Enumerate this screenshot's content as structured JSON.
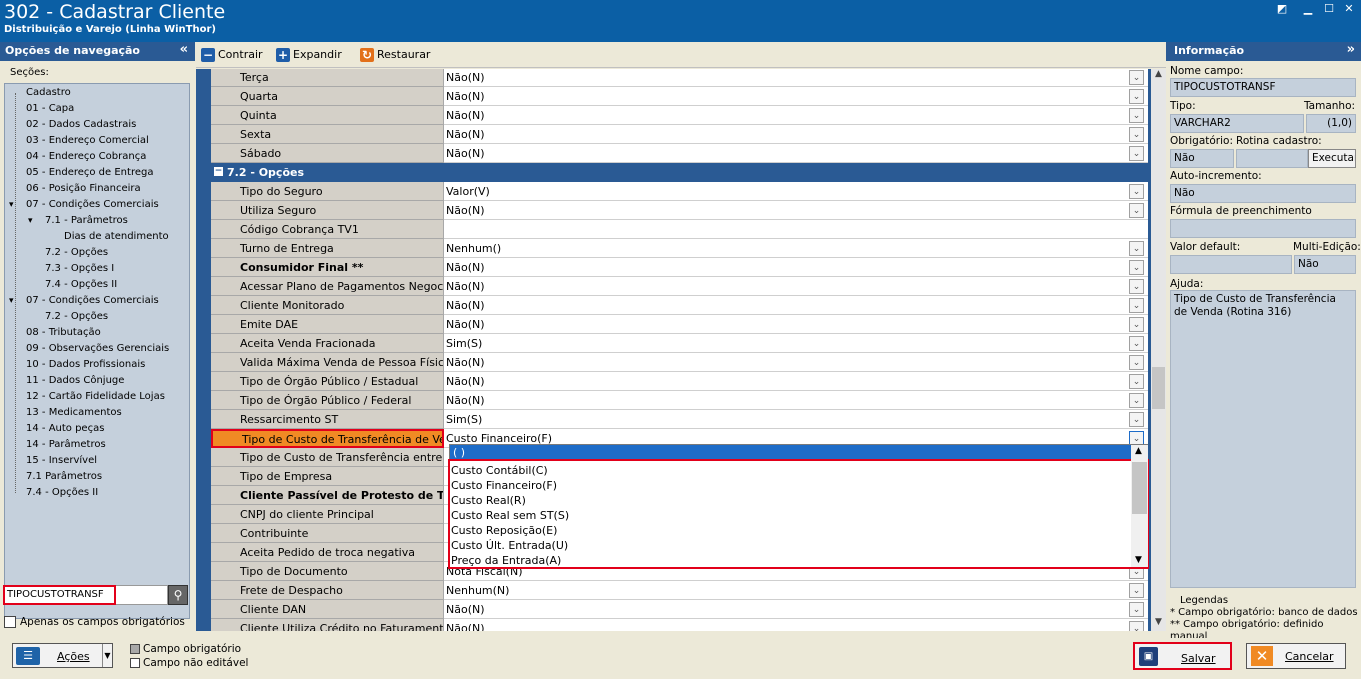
{
  "window": {
    "title": "302 - Cadastrar Cliente",
    "subtitle": "Distribuição e Varejo (Linha WinThor)"
  },
  "left": {
    "header": "Opções de navegação",
    "sections_label": "Seções:",
    "tree": [
      "Cadastro",
      "01 - Capa",
      "02 - Dados Cadastrais",
      "03 - Endereço Comercial",
      "04 - Endereço Cobrança",
      "05 - Endereço de Entrega",
      "06 - Posição Financeira",
      "07 - Condições Comerciais",
      "7.1 - Parâmetros",
      "Dias de atendimento",
      "7.2 - Opções",
      "7.3 - Opções I",
      "7.4 - Opções II",
      "07 - Condições Comerciais",
      "7.2 - Opções",
      "08 - Tributação",
      "09 - Observações Gerenciais",
      "10 - Dados Profissionais",
      "11 - Dados Cônjuge",
      "12 - Cartão Fidelidade Lojas",
      "13 - Medicamentos",
      "14 - Auto peças",
      "14 - Parâmetros",
      "15 - Inservível",
      "7.1 Parâmetros",
      "7.4 - Opções II"
    ],
    "search_value": "TIPOCUSTOTRANSF",
    "only_required": "Apenas os campos obrigatórios"
  },
  "toolbar": {
    "collapse": "Contrair",
    "expand": "Expandir",
    "restore": "Restaurar"
  },
  "grid": {
    "rows_top": [
      {
        "label": "Terça",
        "value": "Não(N)"
      },
      {
        "label": "Quarta",
        "value": "Não(N)"
      },
      {
        "label": "Quinta",
        "value": "Não(N)"
      },
      {
        "label": "Sexta",
        "value": "Não(N)"
      },
      {
        "label": "Sábado",
        "value": "Não(N)"
      }
    ],
    "section": "7.2 - Opções",
    "rows": [
      {
        "label": "Tipo do Seguro",
        "value": "Valor(V)"
      },
      {
        "label": "Utiliza Seguro",
        "value": "Não(N)"
      },
      {
        "label": "Código Cobrança TV1",
        "value": ""
      },
      {
        "label": "Turno de Entrega",
        "value": "Nenhum()"
      },
      {
        "label": "Consumidor Final **",
        "value": "Não(N)"
      },
      {
        "label": "Acessar Plano de Pagamentos Negociados",
        "value": "Não(N)"
      },
      {
        "label": "Cliente Monitorado",
        "value": "Não(N)"
      },
      {
        "label": "Emite DAE",
        "value": "Não(N)"
      },
      {
        "label": "Aceita Venda Fracionada",
        "value": "Sim(S)"
      },
      {
        "label": "Valida Máxima Venda de Pessoa Física",
        "value": "Não(N)"
      },
      {
        "label": "Tipo de Órgão Público / Estadual",
        "value": "Não(N)"
      },
      {
        "label": "Tipo de Órgão Público / Federal",
        "value": "Não(N)"
      },
      {
        "label": "Ressarcimento ST",
        "value": "Sim(S)"
      },
      {
        "label": "Tipo de Custo de Transferência de Venda",
        "value": "Custo Financeiro(F)"
      },
      {
        "label": "Tipo de Custo de Transferência entre Filia",
        "value": ""
      },
      {
        "label": "Tipo de Empresa",
        "value": ""
      },
      {
        "label": "Cliente Passível de Protesto de Títul",
        "value": ""
      },
      {
        "label": "CNPJ do cliente Principal",
        "value": ""
      },
      {
        "label": "Contribuinte",
        "value": ""
      },
      {
        "label": "Aceita Pedido de troca negativa",
        "value": ""
      },
      {
        "label": "Tipo de Documento",
        "value": "Nota Fiscal(N)"
      },
      {
        "label": "Frete de Despacho",
        "value": "Nenhum(N)"
      },
      {
        "label": "Cliente DAN",
        "value": "Não(N)"
      },
      {
        "label": "Cliente Utiliza Crédito no Faturamento",
        "value": "Não(N)"
      }
    ]
  },
  "dropdown": {
    "selected": "( )",
    "options": [
      "Custo Contábil(C)",
      "Custo Financeiro(F)",
      "Custo Real(R)",
      "Custo Real sem ST(S)",
      "Custo Reposição(E)",
      "Custo Últ. Entrada(U)",
      "Preço da Entrada(A)"
    ]
  },
  "info": {
    "header": "Informação",
    "field_name_label": "Nome campo:",
    "field_name": "TIPOCUSTOTRANSF",
    "type_label": "Tipo:",
    "size_label": "Tamanho:",
    "type": "VARCHAR2",
    "size": "(1,0)",
    "required_label": "Obrigatório:",
    "routine_label": "Rotina cadastro:",
    "required": "Não",
    "execute": "Executar",
    "autoinc_label": "Auto-incremento:",
    "autoinc": "Não",
    "formula_label": "Fórmula de preenchimento",
    "default_label": "Valor default:",
    "multi_label": "Multi-Edição:",
    "multi": "Não",
    "help_label": "Ajuda:",
    "help": "Tipo de Custo de Transferência de Venda (Rotina 316)",
    "legend_title": "Legendas",
    "legend1": "* Campo obrigatório: banco de dados",
    "legend2": "** Campo obrigatório: definido manual"
  },
  "bottom": {
    "actions": "Ações",
    "legend_required": "Campo obrigatório",
    "legend_noedit": "Campo não editável",
    "save": "Salvar",
    "cancel": "Cancelar"
  }
}
